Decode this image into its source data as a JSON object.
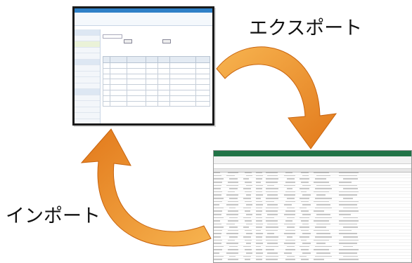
{
  "labels": {
    "export": "エクスポート",
    "import": "インポート"
  },
  "colors": {
    "arrow_light": "#f6a43a",
    "arrow_dark": "#e2791b",
    "accent_blue": "#2f80c7",
    "excel_green": "#217346"
  }
}
